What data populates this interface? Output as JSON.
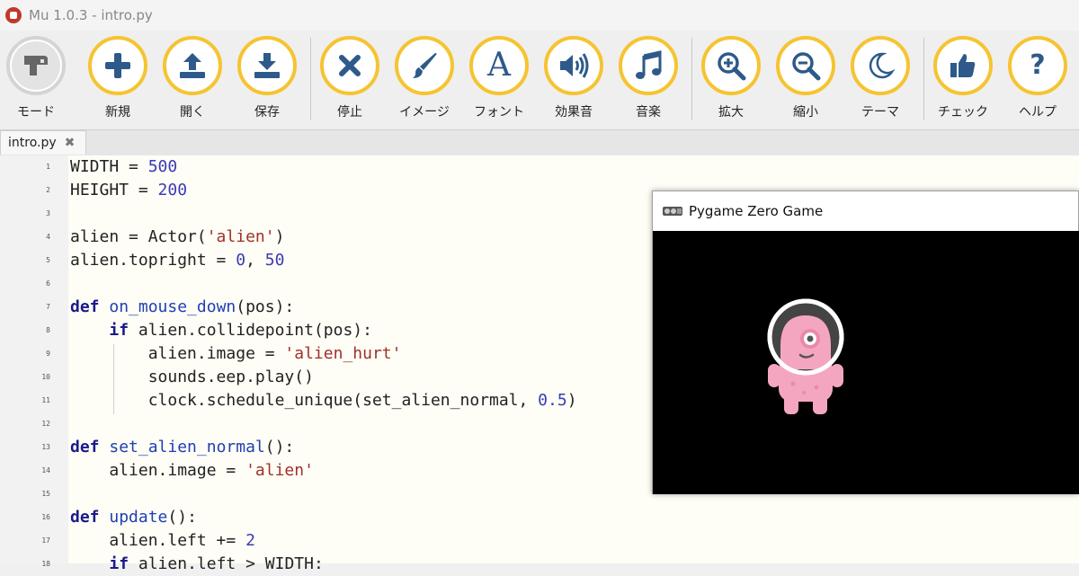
{
  "window": {
    "title": "Mu 1.0.3 - intro.py"
  },
  "toolbar": {
    "buttons": [
      {
        "label": "モード",
        "icon": "mode-icon"
      },
      {
        "label": "新規",
        "icon": "plus-icon"
      },
      {
        "label": "開く",
        "icon": "upload-icon"
      },
      {
        "label": "保存",
        "icon": "download-icon"
      },
      {
        "label": "停止",
        "icon": "close-icon"
      },
      {
        "label": "イメージ",
        "icon": "paintbrush-icon"
      },
      {
        "label": "フォント",
        "icon": "font-icon"
      },
      {
        "label": "効果音",
        "icon": "speaker-icon"
      },
      {
        "label": "音楽",
        "icon": "music-note-icon"
      },
      {
        "label": "拡大",
        "icon": "zoom-in-icon"
      },
      {
        "label": "縮小",
        "icon": "zoom-out-icon"
      },
      {
        "label": "テーマ",
        "icon": "moon-icon"
      },
      {
        "label": "チェック",
        "icon": "thumbs-up-icon"
      },
      {
        "label": "ヘルプ",
        "icon": "help-icon"
      }
    ]
  },
  "tab": {
    "label": "intro.py",
    "close": "✖"
  },
  "editor": {
    "lines": [
      {
        "n": "1",
        "code": "WIDTH = 500"
      },
      {
        "n": "2",
        "code": "HEIGHT = 200"
      },
      {
        "n": "3",
        "code": ""
      },
      {
        "n": "4",
        "code": "alien = Actor('alien')"
      },
      {
        "n": "5",
        "code": "alien.topright = 0, 50"
      },
      {
        "n": "6",
        "code": ""
      },
      {
        "n": "7",
        "code": "def on_mouse_down(pos):"
      },
      {
        "n": "8",
        "code": "    if alien.collidepoint(pos):"
      },
      {
        "n": "9",
        "code": "        alien.image = 'alien_hurt'"
      },
      {
        "n": "10",
        "code": "        sounds.eep.play()"
      },
      {
        "n": "11",
        "code": "        clock.schedule_unique(set_alien_normal, 0.5)"
      },
      {
        "n": "12",
        "code": ""
      },
      {
        "n": "13",
        "code": "def set_alien_normal():"
      },
      {
        "n": "14",
        "code": "    alien.image = 'alien'"
      },
      {
        "n": "15",
        "code": ""
      },
      {
        "n": "16",
        "code": "def update():"
      },
      {
        "n": "17",
        "code": "    alien.left += 2"
      },
      {
        "n": "18",
        "code": "    if alien.left > WIDTH:"
      }
    ]
  },
  "game_window": {
    "title": "Pygame Zero Game",
    "icon": "pygame-icon"
  },
  "colors": {
    "keyword": "#1a1a8c",
    "function": "#1f3fb5",
    "string": "#a0302a",
    "number": "#3b3bb5",
    "accent": "#f5c430",
    "icon": "#2d5a8a",
    "alien": "#f4a6c0"
  }
}
